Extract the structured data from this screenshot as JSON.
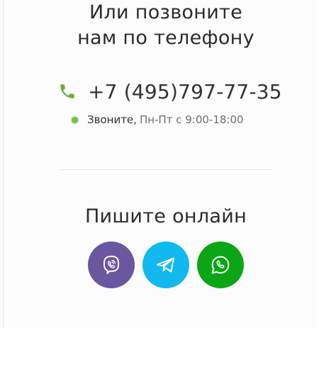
{
  "call_section": {
    "title_line1": "Или позвоните",
    "title_line2": "нам по телефону",
    "phone_number": "+7 (495)797-77-35",
    "hours_label": "Звоните,",
    "hours_value": "Пн-Пт с 9:00-18:00",
    "icon": "phone-icon",
    "status_color": "#79b84a"
  },
  "online_section": {
    "title": "Пишите онлайн",
    "messengers": [
      {
        "name": "viber",
        "icon": "viber-icon",
        "color": "#6b56a0"
      },
      {
        "name": "telegram",
        "icon": "telegram-icon",
        "color": "#11b9ef"
      },
      {
        "name": "whatsapp",
        "icon": "whatsapp-icon",
        "color": "#0aa616"
      }
    ]
  },
  "colors": {
    "phone_icon": "#6aae3b",
    "text": "#2b2b2b",
    "muted": "#6d6d6d"
  }
}
